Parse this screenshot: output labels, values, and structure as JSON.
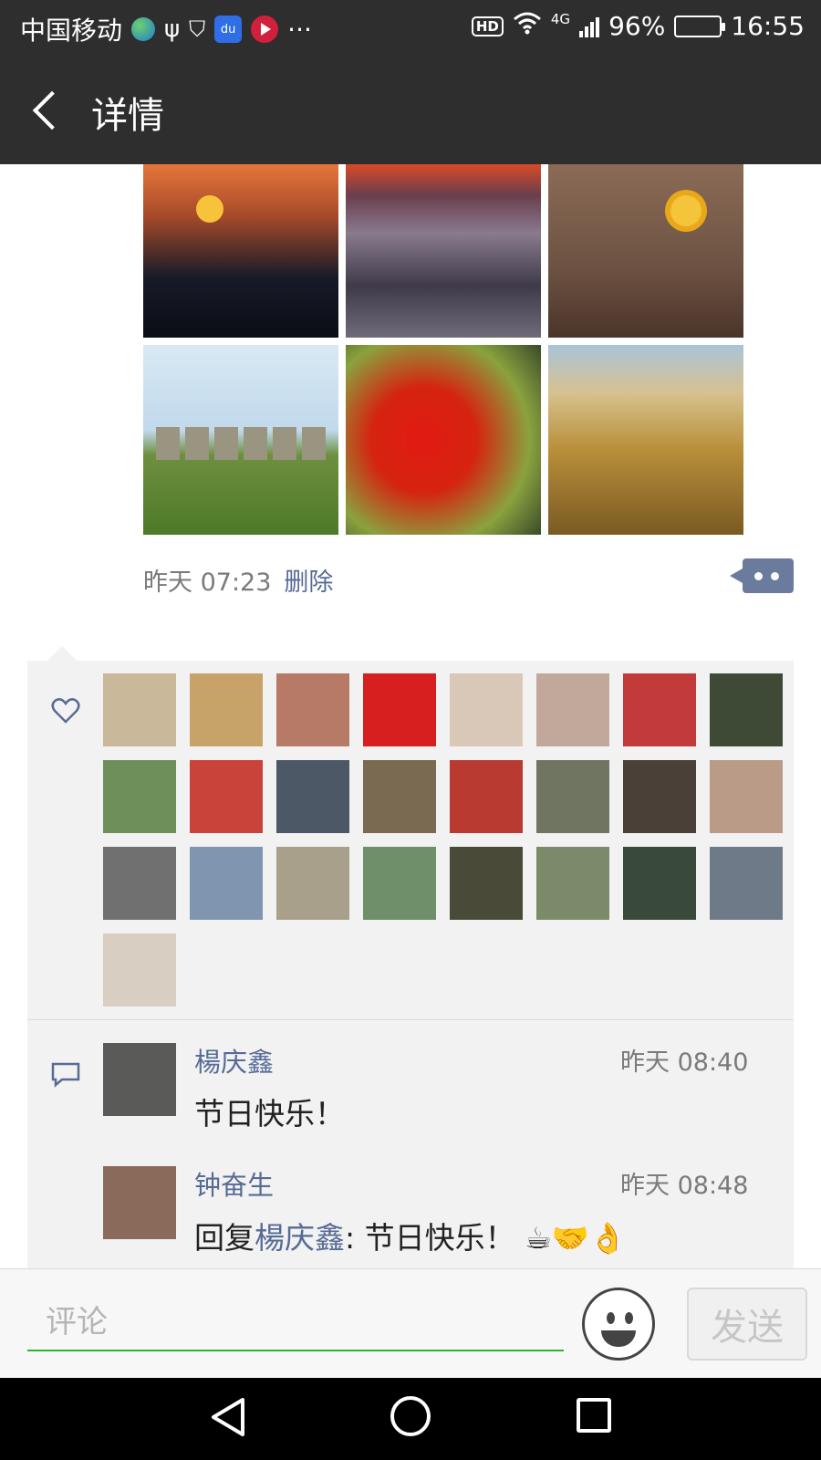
{
  "status_bar": {
    "carrier": "中国移动",
    "more": "···",
    "network": "4G",
    "battery": "96%",
    "time": "16:55",
    "hd": "HD",
    "baidu": "du"
  },
  "header": {
    "title": "详情"
  },
  "post": {
    "photos": [
      {
        "subject": "crane-at-sunset"
      },
      {
        "subject": "misty-rocks-sunset"
      },
      {
        "subject": "sunflower-vases"
      },
      {
        "subject": "stonehenge"
      },
      {
        "subject": "red-maple-leaves"
      },
      {
        "subject": "autumn-valley-village"
      }
    ],
    "time": "昨天 07:23",
    "delete_label": "删除"
  },
  "likes": {
    "avatar_colors": [
      "#c9b89a",
      "#c7a36a",
      "#b77a66",
      "#d81f1f",
      "#d9c7b8",
      "#c2a89a",
      "#c23a3a",
      "#3e4a36",
      "#6f8f5a",
      "#c9433a",
      "#4c5866",
      "#7a6a52",
      "#b83a30",
      "#6f7560",
      "#4a4038",
      "#b99b88",
      "#707070",
      "#7f95b0",
      "#a8a08a",
      "#6f8f6a",
      "#4a4a38",
      "#7d8a6a",
      "#3a4a3a",
      "#6f7a88",
      "#d8cfc2"
    ]
  },
  "comments": [
    {
      "name": "楊庆鑫",
      "time": "昨天 08:40",
      "text": "节日快乐！",
      "avatar_color": "#5a5a58"
    },
    {
      "name": "钟奋生",
      "time": "昨天 08:48",
      "reply_prefix": "回复",
      "reply_to": "楊庆鑫",
      "text": ": 节日快乐！ ☕🤝👌",
      "avatar_color": "#8a6a5a"
    }
  ],
  "input": {
    "placeholder": "评论",
    "send_label": "发送"
  },
  "colors": {
    "link": "#576b95",
    "header_bg": "#2e2e2e",
    "panel_bg": "#f2f2f2",
    "input_underline": "#2fb42f"
  }
}
